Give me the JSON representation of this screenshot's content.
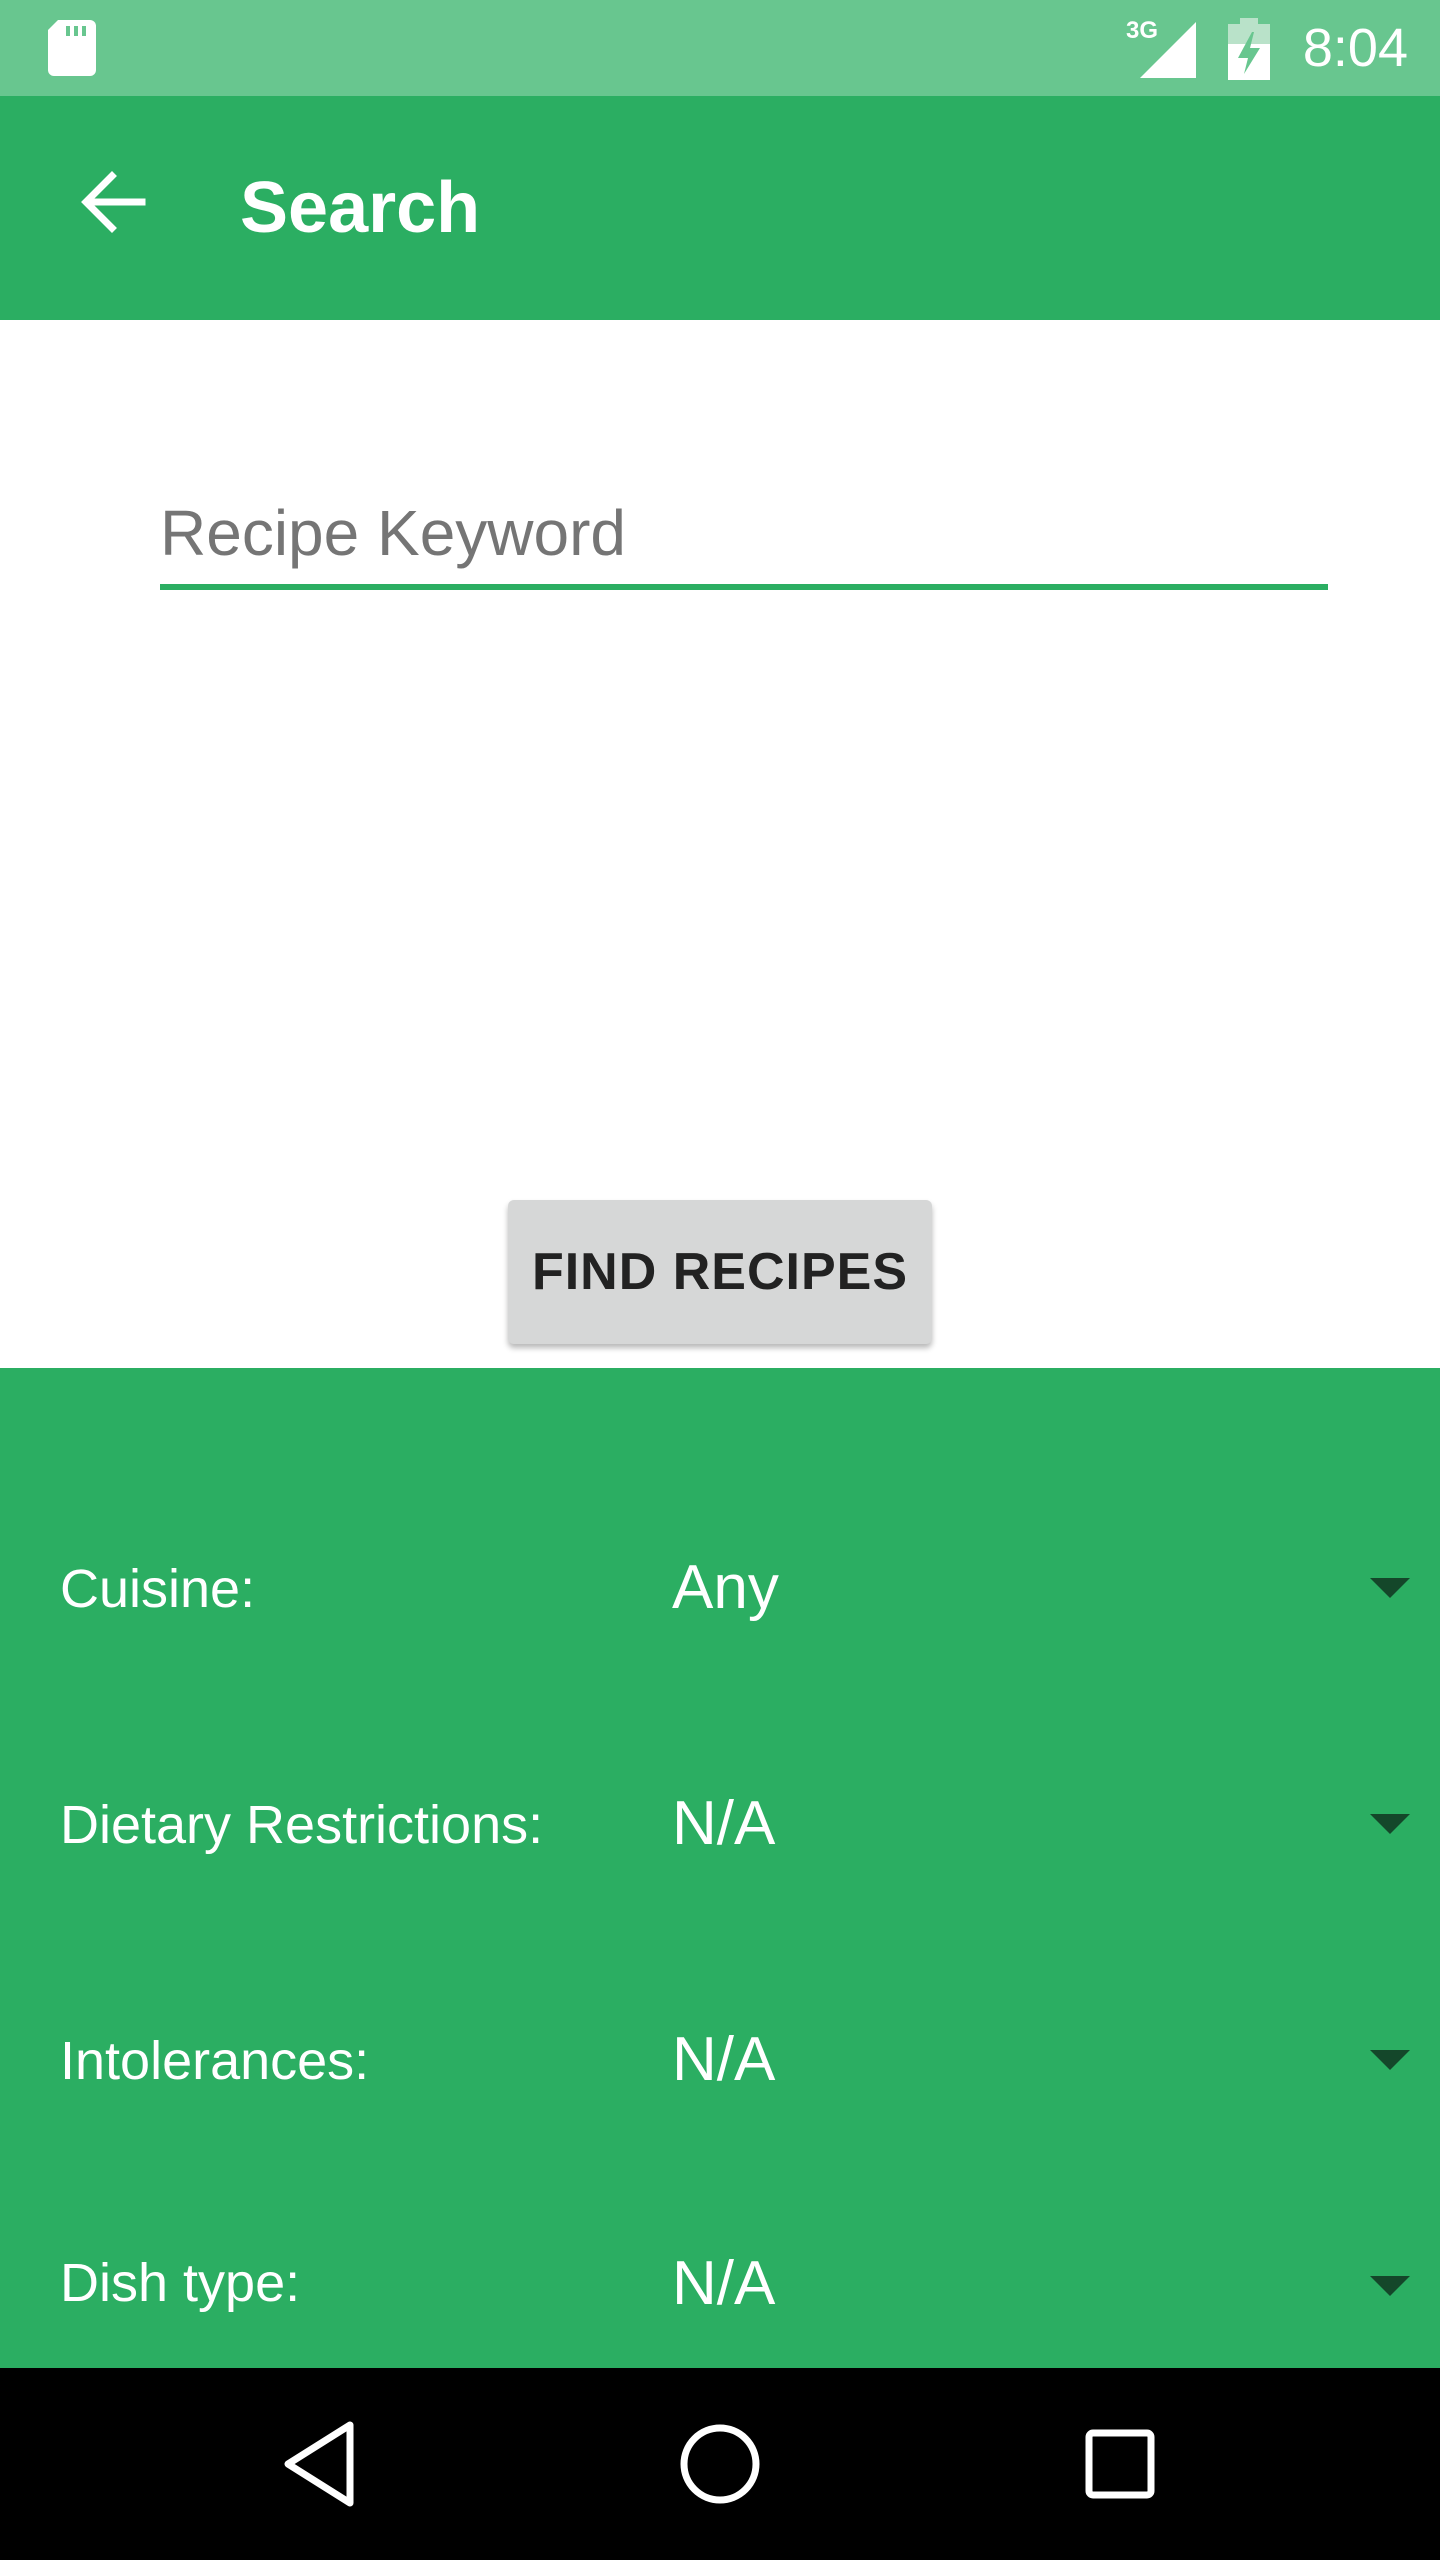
{
  "status_bar": {
    "time": "8:04",
    "network": "3G",
    "icons": [
      "sd-card-icon",
      "signal-icon",
      "battery-charging-icon"
    ]
  },
  "app_bar": {
    "title": "Search",
    "back_icon": "arrow-back-icon"
  },
  "search": {
    "placeholder": "Recipe Keyword",
    "value": "",
    "button_label": "FIND RECIPES"
  },
  "filters": [
    {
      "label": "Cuisine:",
      "value": "Any"
    },
    {
      "label": "Dietary Restrictions:",
      "value": "N/A"
    },
    {
      "label": "Intolerances:",
      "value": "N/A"
    },
    {
      "label": "Dish type:",
      "value": "N/A"
    }
  ],
  "nav_bar": {
    "buttons": [
      "back-triangle-icon",
      "home-circle-icon",
      "recents-square-icon"
    ]
  },
  "colors": {
    "status_bar": "#68c68f",
    "primary": "#2bae62",
    "button": "#d6d7d7",
    "nav_bar": "#000000"
  }
}
